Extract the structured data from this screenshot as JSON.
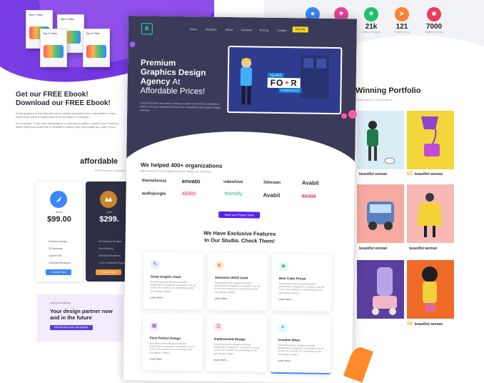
{
  "left": {
    "ebook_title_1": "Get our FREE Ebook!",
    "ebook_title_2": "Download our FREE Ebook!",
    "text_1": "Great graphics is the ultimate way to create separation from competitors. It also helps keep ideas & businesses from evolution, it is simple.",
    "text_2": "For example, if you were shopping for a new beach coffee, wouldn't you? And you would want your business or website to reflect your personality as a part of you.",
    "affordable": "affordable",
    "affordable_sub": "Fair Prices for Superior Design Services",
    "plans": [
      {
        "name": "silver",
        "price": "$99.00",
        "features": [
          "Premium Design",
          "3D Mockups",
          "Layered file",
          "Unlimited Revisions"
        ],
        "button": "Choose Plan"
      },
      {
        "name": "gold",
        "price": "$299.",
        "features": [
          "All Premium Designs",
          "Fast Delivery",
          "Unlimited Revisions",
          "1-On-1 Customer Support"
        ],
        "button": "Choose Plan"
      }
    ],
    "partner_small": "Lead your industry",
    "partner_big": "Your design partner now and in the future",
    "partner_button": "talk talk about your new projects"
  },
  "center": {
    "nav": [
      "Home",
      "Features",
      "About",
      "Services",
      "Pricing",
      "Contact"
    ],
    "nav_cta": "Hire Me",
    "hero_title_1": "Premium",
    "hero_title_2": "Graphics Design",
    "hero_title_3": "Agency",
    "hero_title_4": "At",
    "hero_title_5": "Affordable Prices!",
    "hero_desc": "Check the below are ready to help you stand out from the competition. Need to set your business out from the competitors with graphic design services.",
    "video_years": "YEARS",
    "video_four": "FOUR",
    "video_exp": "EXPERIENCE",
    "helped": "We helped 400+ organizations",
    "helped_sub": "We're proud of our Designers and our clients our one more",
    "brands": [
      "themeforest",
      "envato",
      "videohive",
      "3docean",
      "Avabil",
      "audiojungle",
      "XERO",
      "themefy",
      "Avabil",
      "asaia"
    ],
    "start_button": "Start your Project Now!",
    "features_title_1": "We Have Exclusive Features",
    "features_title_2": "In Our Studio. Check Them!",
    "features": [
      {
        "title": "Great Graphic Used",
        "desc": "Everything works designed whether producing for magazine, a website or an ad. In fact, the creative is in everything we do and design, whatch.",
        "more": "Learn More →"
      },
      {
        "title": "Awesome UI/UX Used",
        "desc": "Everything works designed whether producing for magazine, a website or an ad. In fact, the creative is in everything we do and design, whatch.",
        "more": "Learn More →"
      },
      {
        "title": "Best Color Preset",
        "desc": "Everything works designed whether producing for magazine, a website or an ad. In fact, the creative is in everything we do and design, whatch.",
        "more": "Learn More →"
      },
      {
        "title": "Pixel Perfect Design",
        "desc": "Everything works designed whether producing for magazine, a website or an ad. In fact, the creative is in everything we do and design, whatch.",
        "more": "Learn More →"
      },
      {
        "title": "Implemented Design",
        "desc": "Everything works designed whether producing for magazine, a website or an ad. In fact, the creative is in everything we do and design, whatch.",
        "more": "Learn More →"
      },
      {
        "title": "Creative Ideas",
        "desc": "Everything works designed whether producing for magazine, a website or an ad. In fact, the creative is in everything we do and design, whatch.",
        "more": "Learn More →"
      }
    ]
  },
  "right": {
    "stats": [
      {
        "num": "",
        "label": "",
        "color": "#3a86ff"
      },
      {
        "num": "",
        "label": "",
        "color": "#e84393"
      },
      {
        "num": "21k",
        "label": "Lines of Projects",
        "color": "#20bf6b"
      },
      {
        "num": "121",
        "label": "Projects Done",
        "color": "#fa8231"
      },
      {
        "num": "7000",
        "label": "Satisfied Clients",
        "color": "#eb3b5a"
      }
    ],
    "portfolio_title": "Winning Portfolio",
    "portfolio_sub": "Lorem ipsum to your projects",
    "tiles": [
      {
        "num": "",
        "caption": "beautiful woman"
      },
      {
        "num": "03",
        "caption": "beautiful woman"
      },
      {
        "num": "",
        "caption": "beautiful woman"
      },
      {
        "num": "",
        "caption": "beautiful woman"
      },
      {
        "num": "09",
        "caption": "beautiful woman"
      }
    ]
  }
}
